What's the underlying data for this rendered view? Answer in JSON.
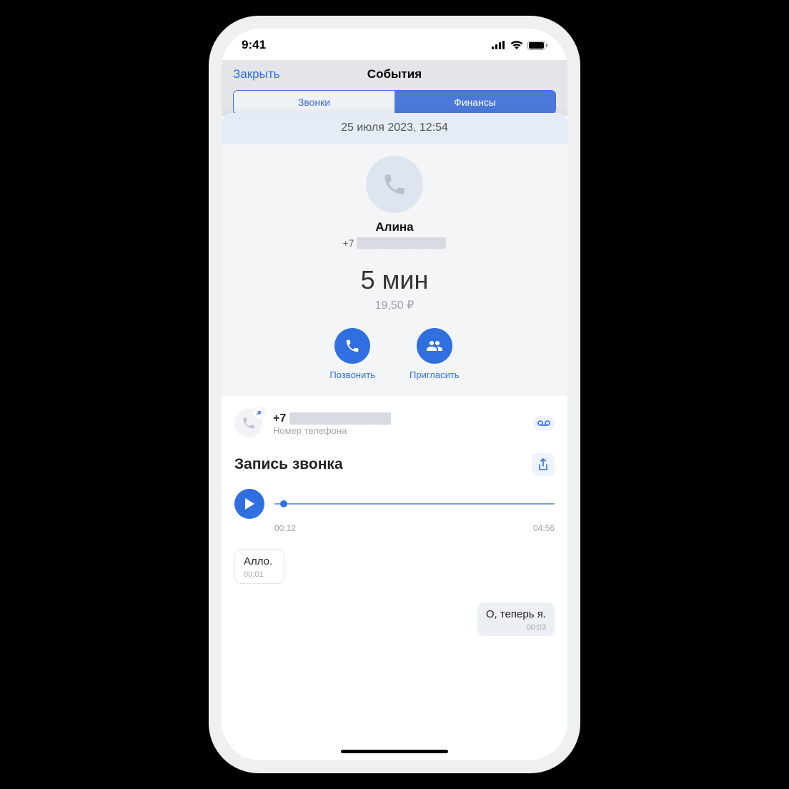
{
  "status": {
    "time": "9:41"
  },
  "modal": {
    "close": "Закрыть",
    "title": "События",
    "tabs": {
      "calls": "Звонки",
      "finance": "Финансы"
    }
  },
  "detail": {
    "datetime": "25 июля 2023, 12:54",
    "name": "Алина",
    "phone_prefix": "+7",
    "phone_masked": "▇▇▇ ▇▇▇-▇▇-▇▇",
    "duration": "5 мин",
    "cost": "19,50 ₽",
    "actions": {
      "call": "Позвонить",
      "invite": "Пригласить"
    }
  },
  "phone_row": {
    "prefix": "+7",
    "masked": "▇▇▇ ▇▇▇-▇▇-▇▇",
    "sub": "Номер телефона"
  },
  "recording": {
    "title": "Запись звонка",
    "elapsed": "00:12",
    "total": "04:56"
  },
  "transcript": {
    "left": {
      "text": "Алло.",
      "time": "00:01"
    },
    "right": {
      "text": "О, теперь я.",
      "time": "00:03"
    }
  }
}
